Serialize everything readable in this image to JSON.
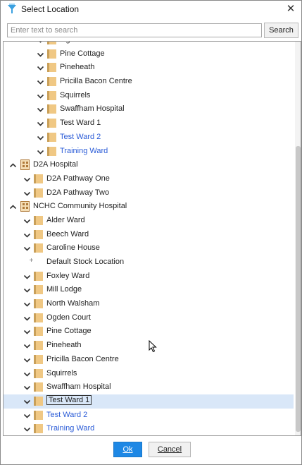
{
  "window": {
    "title": "Select Location",
    "close_glyph": "✕",
    "app_icon": "funnel-logo-icon"
  },
  "search": {
    "placeholder": "Enter text to search",
    "value": "",
    "button_label": "Search"
  },
  "tree": {
    "rows": [
      {
        "level": 2,
        "kind": "folder",
        "expander": "collapsed",
        "label": "Ogden Court",
        "style": "normal"
      },
      {
        "level": 2,
        "kind": "folder",
        "expander": "collapsed",
        "label": "Pine Cottage",
        "style": "normal"
      },
      {
        "level": 2,
        "kind": "folder",
        "expander": "collapsed",
        "label": "Pineheath",
        "style": "normal"
      },
      {
        "level": 2,
        "kind": "folder",
        "expander": "collapsed",
        "label": "Pricilla Bacon Centre",
        "style": "normal"
      },
      {
        "level": 2,
        "kind": "folder",
        "expander": "collapsed",
        "label": "Squirrels",
        "style": "normal"
      },
      {
        "level": 2,
        "kind": "folder",
        "expander": "collapsed",
        "label": "Swaffham Hospital",
        "style": "normal"
      },
      {
        "level": 2,
        "kind": "folder",
        "expander": "collapsed",
        "label": "Test Ward 1",
        "style": "normal"
      },
      {
        "level": 2,
        "kind": "folder",
        "expander": "collapsed",
        "label": "Test Ward 2",
        "style": "link"
      },
      {
        "level": 2,
        "kind": "folder",
        "expander": "collapsed",
        "label": "Training Ward",
        "style": "link"
      },
      {
        "level": 0,
        "kind": "building",
        "expander": "expanded",
        "label": "D2A Hospital",
        "style": "normal"
      },
      {
        "level": 1,
        "kind": "folder",
        "expander": "collapsed",
        "label": "D2A Pathway One",
        "style": "normal"
      },
      {
        "level": 1,
        "kind": "folder",
        "expander": "collapsed",
        "label": "D2A Pathway Two",
        "style": "normal"
      },
      {
        "level": 0,
        "kind": "building",
        "expander": "expanded",
        "label": "NCHC Community Hospital",
        "style": "normal"
      },
      {
        "level": 1,
        "kind": "folder",
        "expander": "collapsed",
        "label": "Alder Ward",
        "style": "normal"
      },
      {
        "level": 1,
        "kind": "folder",
        "expander": "collapsed",
        "label": "Beech Ward",
        "style": "normal"
      },
      {
        "level": 1,
        "kind": "folder",
        "expander": "collapsed",
        "label": "Caroline House",
        "style": "normal"
      },
      {
        "level": 1,
        "kind": "leaf",
        "expander": "none",
        "label": "Default Stock Location",
        "style": "normal"
      },
      {
        "level": 1,
        "kind": "folder",
        "expander": "collapsed",
        "label": "Foxley Ward",
        "style": "normal"
      },
      {
        "level": 1,
        "kind": "folder",
        "expander": "collapsed",
        "label": "Mill Lodge",
        "style": "normal"
      },
      {
        "level": 1,
        "kind": "folder",
        "expander": "collapsed",
        "label": "North Walsham",
        "style": "normal"
      },
      {
        "level": 1,
        "kind": "folder",
        "expander": "collapsed",
        "label": "Ogden Court",
        "style": "normal"
      },
      {
        "level": 1,
        "kind": "folder",
        "expander": "collapsed",
        "label": "Pine Cottage",
        "style": "normal"
      },
      {
        "level": 1,
        "kind": "folder",
        "expander": "collapsed",
        "label": "Pineheath",
        "style": "normal"
      },
      {
        "level": 1,
        "kind": "folder",
        "expander": "collapsed",
        "label": "Pricilla Bacon Centre",
        "style": "normal"
      },
      {
        "level": 1,
        "kind": "folder",
        "expander": "collapsed",
        "label": "Squirrels",
        "style": "normal"
      },
      {
        "level": 1,
        "kind": "folder",
        "expander": "collapsed",
        "label": "Swaffham Hospital",
        "style": "normal"
      },
      {
        "level": 1,
        "kind": "folder",
        "expander": "collapsed",
        "label": "Test Ward 1",
        "style": "selected"
      },
      {
        "level": 1,
        "kind": "folder",
        "expander": "collapsed",
        "label": "Test Ward 2",
        "style": "link"
      },
      {
        "level": 1,
        "kind": "folder",
        "expander": "collapsed",
        "label": "Training Ward",
        "style": "link"
      }
    ]
  },
  "footer": {
    "ok_label": "Ok",
    "cancel_label": "Cancel"
  },
  "colors": {
    "accent": "#1e88e5",
    "link": "#2a5bd7",
    "selection": "#d9e7f8",
    "folder": "#f0c884"
  }
}
